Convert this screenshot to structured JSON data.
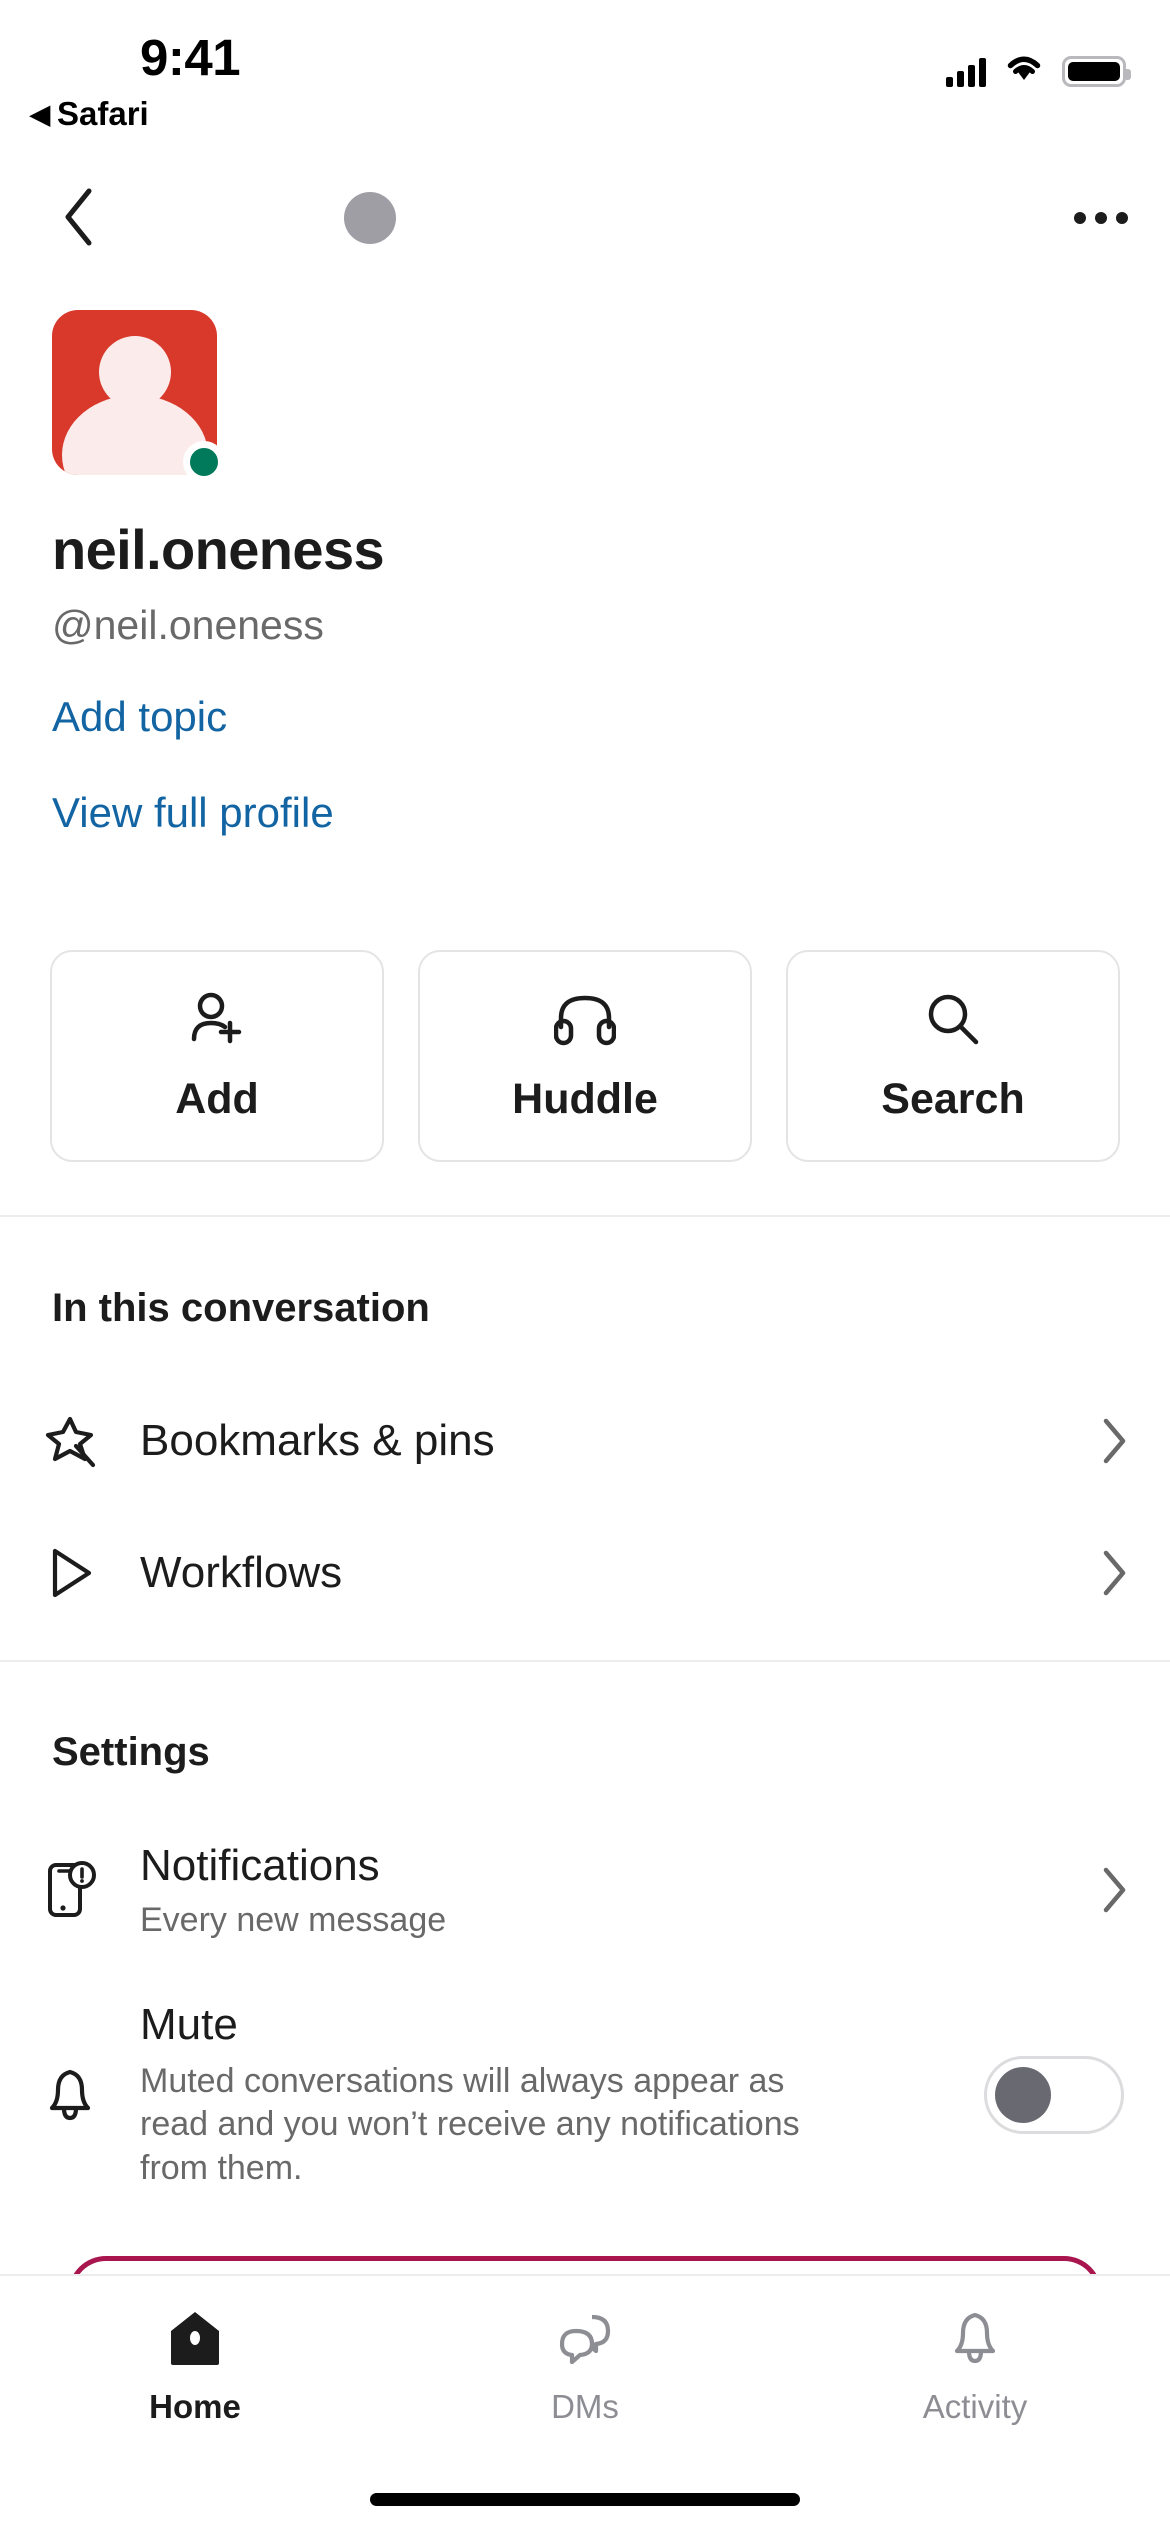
{
  "status_bar": {
    "time": "9:41",
    "back_app": "Safari",
    "back_glyph": "◀",
    "icons": [
      "cellular-signal-icon",
      "wifi-icon",
      "battery-icon"
    ]
  },
  "nav_bar": {
    "back_icon": "chevron-left-icon",
    "avatar_icon": "avatar-placeholder",
    "more_icon": "more-options-icon"
  },
  "profile": {
    "avatar_icon": "user-avatar-icon",
    "avatar_color": "#d8392b",
    "presence_color": "#007a5a",
    "presence_label": "online",
    "display_name": "neil.oneness",
    "handle": "@neil.oneness",
    "add_topic_link": "Add topic",
    "view_profile_link": "View full profile",
    "link_color": "#1264a3"
  },
  "actions": [
    {
      "label": "Add",
      "icon": "add-person-icon"
    },
    {
      "label": "Huddle",
      "icon": "headphones-icon"
    },
    {
      "label": "Search",
      "icon": "search-icon"
    }
  ],
  "conversation_section": {
    "title": "In this conversation",
    "items": [
      {
        "label": "Bookmarks & pins",
        "icon": "pin-icon",
        "chevron": "chevron-right-icon"
      },
      {
        "label": "Workflows",
        "icon": "play-triangle-icon",
        "chevron": "chevron-right-icon"
      }
    ]
  },
  "settings_section": {
    "title": "Settings",
    "notifications": {
      "label": "Notifications",
      "value": "Every new message",
      "icon": "mobile-notification-icon",
      "chevron": "chevron-right-icon"
    },
    "mute": {
      "label": "Mute",
      "description": "Muted conversations will always appear as read and you won’t receive any notifications from them.",
      "icon": "bell-icon",
      "toggle_state": "off"
    }
  },
  "sheet_edge_color": "#a9164f",
  "tab_bar": {
    "tabs": [
      {
        "label": "Home",
        "icon": "home-icon",
        "active": true
      },
      {
        "label": "DMs",
        "icon": "dms-icon",
        "active": false
      },
      {
        "label": "Activity",
        "icon": "bell-icon",
        "active": false
      }
    ]
  }
}
